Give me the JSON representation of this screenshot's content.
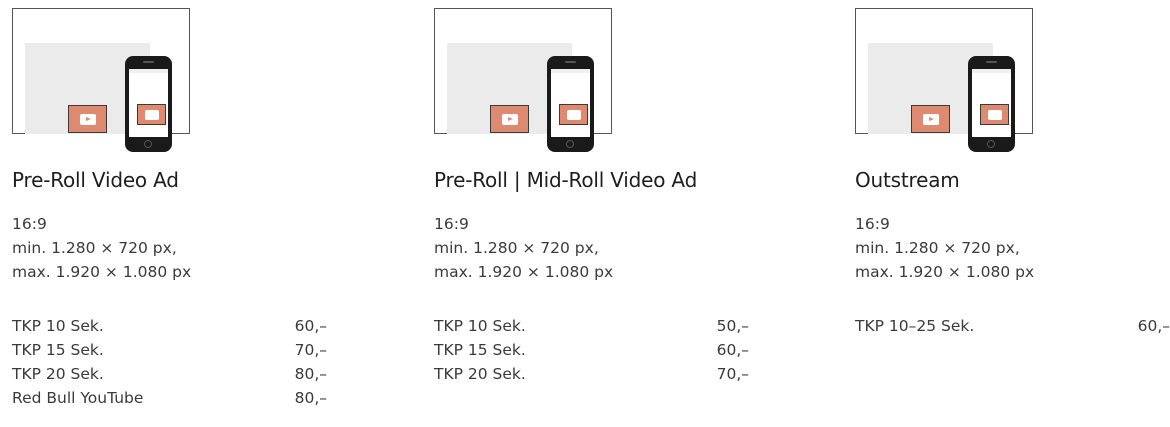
{
  "colors": {
    "play_box": "#dd8a70",
    "frame": "#555555",
    "phone": "#1a1a1a",
    "text": "#1e1e1e"
  },
  "products": [
    {
      "title": "Pre-Roll Video Ad",
      "spec": [
        "16:9",
        "min. 1.280 × 720 px,",
        "max. 1.920 × 1.080 px"
      ],
      "prices": [
        {
          "label": "TKP 10 Sek.",
          "value": "60,–"
        },
        {
          "label": "TKP 15 Sek.",
          "value": "70,–"
        },
        {
          "label": "TKP 20 Sek.",
          "value": "80,–"
        },
        {
          "label": "Red Bull YouTube",
          "value": "80,–"
        }
      ]
    },
    {
      "title": "Pre-Roll | Mid-Roll Video Ad",
      "spec": [
        "16:9",
        "min. 1.280 × 720 px,",
        "max. 1.920 × 1.080 px"
      ],
      "prices": [
        {
          "label": "TKP 10 Sek.",
          "value": "50,–"
        },
        {
          "label": "TKP 15 Sek.",
          "value": "60,–"
        },
        {
          "label": "TKP 20 Sek.",
          "value": "70,–"
        }
      ]
    },
    {
      "title": "Outstream",
      "spec": [
        "16:9",
        "min. 1.280 × 720 px,",
        "max. 1.920 × 1.080 px"
      ],
      "prices": [
        {
          "label": "TKP 10–25 Sek.",
          "value": "60,–"
        }
      ]
    }
  ]
}
